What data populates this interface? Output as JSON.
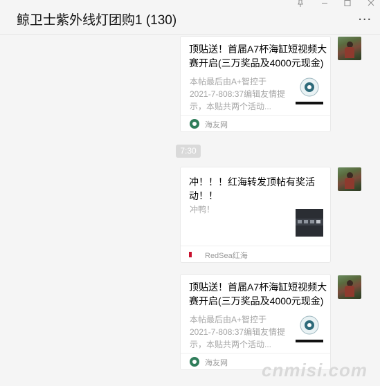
{
  "header": {
    "title": "鲸卫士紫外线灯团购1 (130)",
    "more_label": "..."
  },
  "messages": [
    {
      "title": "顶贴送！首届A7杯海缸短视频大赛开启(三万奖品及4000元现金)",
      "desc": "本帖最后由A+智控于 2021-7-808:37编辑友情提示，本贴共两个活动...",
      "source": "海友网",
      "source_icon": "haiyou-icon"
    },
    {
      "title": "冲！！！红海转发顶帖有奖活动！！",
      "desc": "冲鸭！",
      "source": "RedSea红海",
      "source_icon": "redsea-icon"
    },
    {
      "title": "顶贴送！首届A7杯海缸短视频大赛开启(三万奖品及4000元现金)",
      "desc": "本帖最后由A+智控于 2021-7-808:37编辑友情提示，本贴共两个活动...",
      "source": "海友网",
      "source_icon": "haiyou-icon"
    }
  ],
  "timestamp": "7:30",
  "watermark": "cnmisi.com",
  "colors": {
    "background": "#f5f5f5",
    "card": "#ffffff",
    "desc_text": "#a5a5a5",
    "timestamp_bg": "#dadada"
  }
}
